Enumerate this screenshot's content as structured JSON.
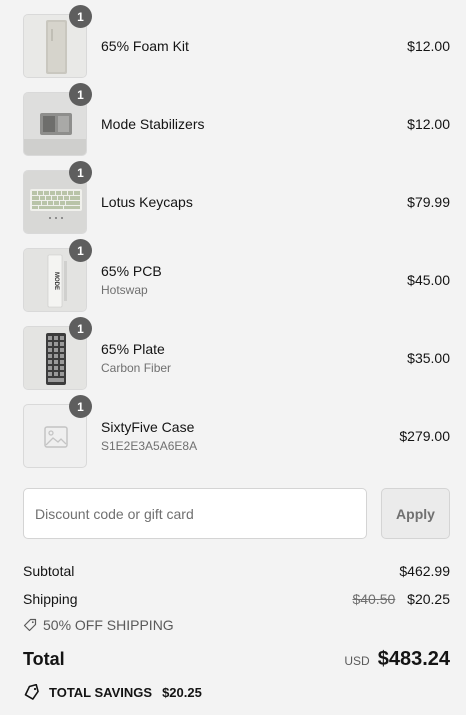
{
  "items": [
    {
      "name": "65% Foam Kit",
      "variant": "",
      "price": "$12.00",
      "quantity": "1",
      "thumb": "foam-kit"
    },
    {
      "name": "Mode Stabilizers",
      "variant": "",
      "price": "$12.00",
      "quantity": "1",
      "thumb": "stabilizers"
    },
    {
      "name": "Lotus Keycaps",
      "variant": "",
      "price": "$79.99",
      "quantity": "1",
      "thumb": "keycaps"
    },
    {
      "name": "65% PCB",
      "variant": "Hotswap",
      "price": "$45.00",
      "quantity": "1",
      "thumb": "pcb",
      "thumb_text": "MODE"
    },
    {
      "name": "65% Plate",
      "variant": "Carbon Fiber",
      "price": "$35.00",
      "quantity": "1",
      "thumb": "plate"
    },
    {
      "name": "SixtyFive Case",
      "variant": "S1E2E3A5A6E8A",
      "price": "$279.00",
      "quantity": "1",
      "thumb": "placeholder"
    }
  ],
  "discount": {
    "placeholder": "Discount code or gift card",
    "apply_label": "Apply"
  },
  "summary": {
    "subtotal_label": "Subtotal",
    "subtotal_value": "$462.99",
    "shipping_label": "Shipping",
    "shipping_original": "$40.50",
    "shipping_value": "$20.25",
    "promo_label": "50% OFF SHIPPING",
    "total_label": "Total",
    "currency": "USD",
    "total_value": "$483.24",
    "savings_label": "TOTAL SAVINGS",
    "savings_value": "$20.25"
  },
  "colors": {
    "background": "#f3f3f3",
    "badge": "#5e5e5e",
    "text": "#141414",
    "muted": "#707070"
  }
}
